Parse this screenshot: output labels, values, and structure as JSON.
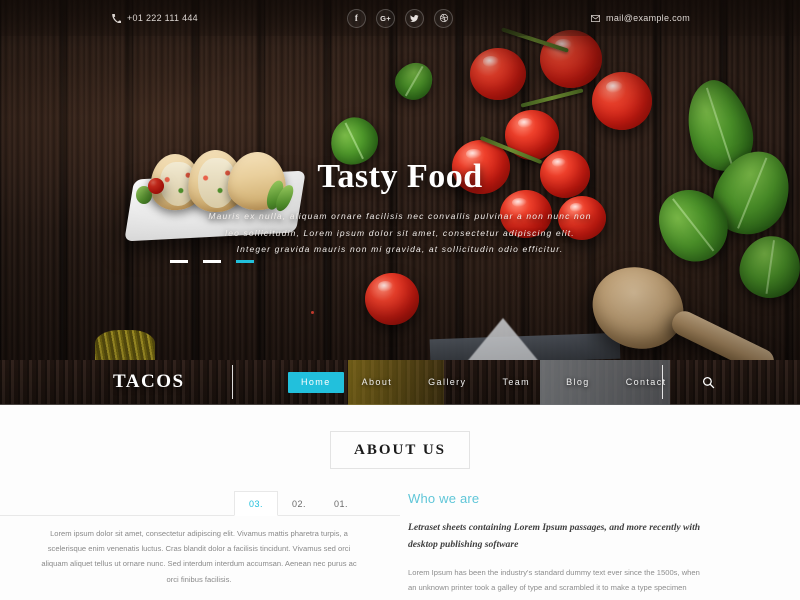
{
  "topbar": {
    "phone": "+01 222 111 444",
    "email": "mail@example.com",
    "phone_icon": "phone-icon",
    "mail_icon": "envelope-icon",
    "social": [
      {
        "name": "facebook",
        "glyph": "f"
      },
      {
        "name": "google-plus",
        "glyph": "G+"
      },
      {
        "name": "twitter",
        "glyph": "t"
      },
      {
        "name": "dribbble",
        "glyph": "⌘"
      }
    ]
  },
  "hero": {
    "title": "Tasty Food",
    "subtitle_line1": "Mauris ex nulla, aliquam ornare facilisis nec convallis pulvinar a non nunc non",
    "subtitle_line2": "leo sollicitudin, Lorem ipsum dolor sit amet, consectetur adipiscing elit.",
    "subtitle_line3": "Integer gravida mauris non mi gravida, at sollicitudin odio efficitur.",
    "slides": [
      {
        "label": "slide-1",
        "active": false
      },
      {
        "label": "slide-2",
        "active": false
      },
      {
        "label": "slide-3",
        "active": true
      }
    ]
  },
  "nav": {
    "logo": "TACOS",
    "items": [
      {
        "label": "Home",
        "active": true
      },
      {
        "label": "About",
        "active": false
      },
      {
        "label": "Gallery",
        "active": false
      },
      {
        "label": "Team",
        "active": false
      },
      {
        "label": "Blog",
        "active": false
      },
      {
        "label": "Contact",
        "active": false
      }
    ],
    "search_icon": "search-icon"
  },
  "about": {
    "heading": "ABOUT US",
    "tabs": [
      {
        "label": "03.",
        "active": true
      },
      {
        "label": "02.",
        "active": false
      },
      {
        "label": "01.",
        "active": false
      }
    ],
    "tab_text": "Lorem ipsum dolor sit amet, consectetur adipiscing elit. Vivamus mattis pharetra turpis, a scelerisque enim venenatis luctus. Cras blandit dolor a facilisis tincidunt. Vivamus sed orci aliquam aliquet tellus ut ornare nunc. Sed interdum interdum accumsan. Aenean nec purus ac orci finibus facilisis.",
    "who_heading": "Who we are",
    "lead": "Letraset sheets containing Lorem Ipsum passages, and more recently with desktop publishing software",
    "paragraph": "Lorem Ipsum has been the industry's standard dummy text ever since the 1500s, when an unknown printer took a galley of type and scrambled it to make a type specimen"
  },
  "colors": {
    "accent": "#22c0dc",
    "accent_soft": "#5fc6d8",
    "hero_bg": "#2b1d16",
    "nav_bg": "#1d120d",
    "section_bg": "#fdfdfd"
  }
}
